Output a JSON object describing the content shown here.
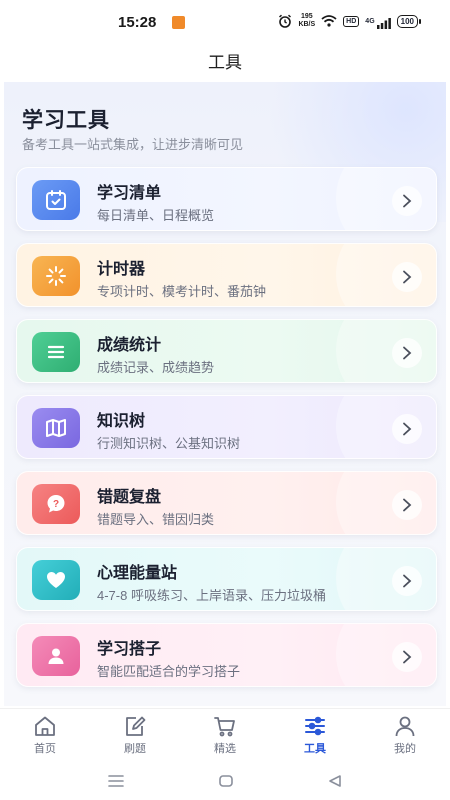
{
  "status": {
    "time": "15:28",
    "badge": "HD",
    "speed_top": "195",
    "speed_bottom": "KB/S",
    "hd": "HD",
    "network": "4G",
    "battery": "100"
  },
  "nav": {
    "title": "工具"
  },
  "page": {
    "heading": "学习工具",
    "subtitle": "备考工具一站式集成，让进步清晰可见"
  },
  "cards": [
    {
      "title": "学习清单",
      "desc": "每日清单、日程概览",
      "icon": "calendar-check-icon",
      "color": "#5a8cf0"
    },
    {
      "title": "计时器",
      "desc": "专项计时、模考计时、番茄钟",
      "icon": "timer-spinner-icon",
      "color": "#f5a23a"
    },
    {
      "title": "成绩统计",
      "desc": "成绩记录、成绩趋势",
      "icon": "list-lines-icon",
      "color": "#3cbf84"
    },
    {
      "title": "知识树",
      "desc": "行测知识树、公基知识树",
      "icon": "map-icon",
      "color": "#8a7be8"
    },
    {
      "title": "错题复盘",
      "desc": "错题导入、错因归类",
      "icon": "question-bubble-icon",
      "color": "#f26b6b"
    },
    {
      "title": "心理能量站",
      "desc": "4-7-8 呼吸练习、上岸语录、压力垃圾桶",
      "icon": "heart-icon",
      "color": "#2fbfc8"
    },
    {
      "title": "学习搭子",
      "desc": "智能匹配适合的学习搭子",
      "icon": "person-icon",
      "color": "#ee74a8"
    }
  ],
  "tabs": [
    {
      "label": "首页",
      "icon": "home-icon",
      "active": false
    },
    {
      "label": "刷题",
      "icon": "edit-icon",
      "active": false
    },
    {
      "label": "精选",
      "icon": "cart-icon",
      "active": false
    },
    {
      "label": "工具",
      "icon": "sliders-icon",
      "active": true
    },
    {
      "label": "我的",
      "icon": "user-icon",
      "active": false
    }
  ]
}
